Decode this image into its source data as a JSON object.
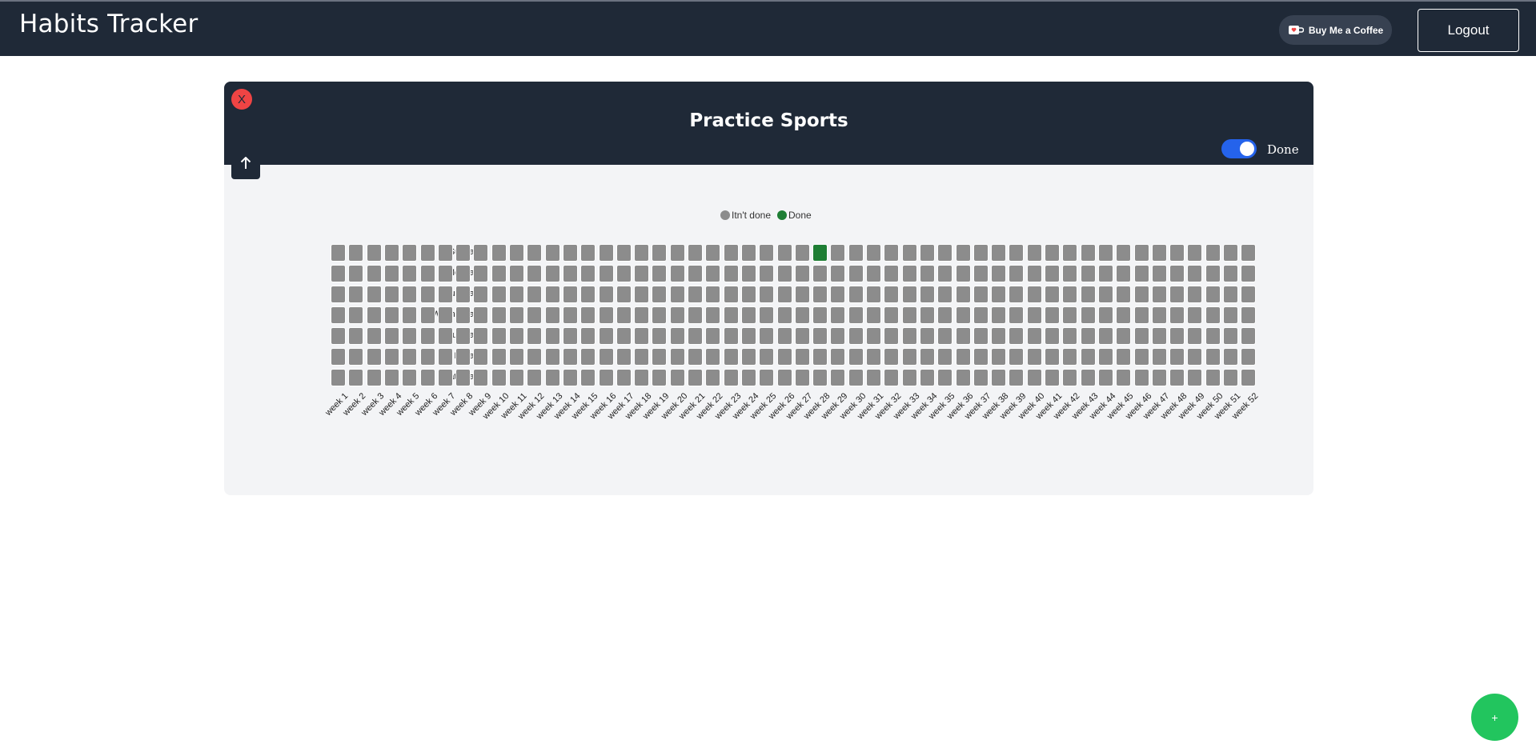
{
  "header": {
    "title": "Habits Tracker",
    "coffee_label": "Buy Me a Coffee",
    "logout_label": "Logout"
  },
  "habit": {
    "title": "Practice Sports",
    "close_label": "X",
    "toggle_label": "Done",
    "toggle_on": true
  },
  "legend": {
    "not_done": "Itn't done",
    "done": "Done"
  },
  "days": [
    "Sunday",
    "Monday",
    "Tuesday",
    "Wednesday",
    "Thursday",
    "Friday",
    "Saturday"
  ],
  "weeks": [
    "week 1",
    "week 2",
    "week 3",
    "week 4",
    "week 5",
    "week 6",
    "week 7",
    "week 8",
    "week 9",
    "week 10",
    "week 11",
    "week 12",
    "week 13",
    "week 14",
    "week 15",
    "week 16",
    "week 17",
    "week 18",
    "week 19",
    "week 20",
    "week 21",
    "week 22",
    "week 23",
    "week 24",
    "week 25",
    "week 26",
    "week 27",
    "week 28",
    "week 29",
    "week 30",
    "week 31",
    "week 32",
    "week 33",
    "week 34",
    "week 35",
    "week 36",
    "week 37",
    "week 38",
    "week 39",
    "week 40",
    "week 41",
    "week 42",
    "week 43",
    "week 44",
    "week 45",
    "week 46",
    "week 47",
    "week 48",
    "week 49",
    "week 50",
    "week 51",
    "week 52"
  ],
  "done_cells": [
    {
      "week": "week 28",
      "day": "Sunday"
    }
  ],
  "fab_label": "+",
  "colors": {
    "not_done": "#8c8c8c",
    "done": "#1e7e34",
    "header_bg": "#1f2937",
    "accent": "#2563eb"
  }
}
